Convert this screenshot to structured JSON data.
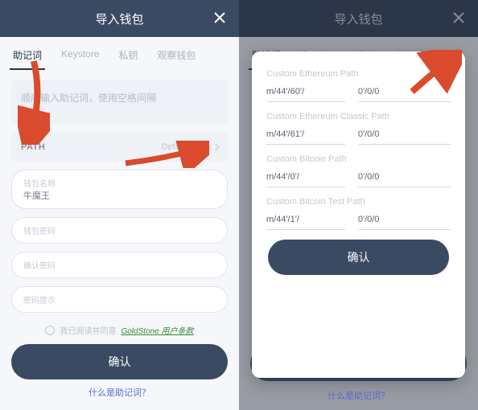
{
  "left": {
    "header": {
      "title": "导入钱包"
    },
    "tabs": [
      "助记词",
      "Keystore",
      "私钥",
      "观察钱包"
    ],
    "activeTabIndex": 0,
    "mnemonicPlaceholder": "顺序输入助记词，使用空格间隔",
    "path": {
      "label": "PATH",
      "value": "Default Path"
    },
    "fields": {
      "name": {
        "label": "钱包名称",
        "value": "牛魔王"
      },
      "password": {
        "label": "钱包密码"
      },
      "confirmPassword": {
        "label": "确认密码"
      },
      "hint": {
        "label": "密码提示"
      }
    },
    "agree": {
      "prefix": "我已阅读并同意",
      "link": "GoldStone 用户条款"
    },
    "confirm": "确认",
    "whatLink": "什么是助记词？"
  },
  "right": {
    "header": {
      "title": "导入钱包"
    },
    "tabs": [
      "助记词",
      "Keystore",
      "私钥",
      "观察钱包"
    ],
    "modal": {
      "groups": [
        {
          "label": "Custom Ethereum Path",
          "prefix": "m/44'/60'/",
          "suffix": "0'/0/0"
        },
        {
          "label": "Custom Ethereum Classic Path",
          "prefix": "m/44'/61'/",
          "suffix": "0'/0/0"
        },
        {
          "label": "Custom Bitcoin Path",
          "prefix": "m/44'/0'/",
          "suffix": "0'/0/0"
        },
        {
          "label": "Custom Bitcoin Test Path",
          "prefix": "m/44'/1'/",
          "suffix": "0'/0/0"
        }
      ],
      "confirm": "确认"
    },
    "confirm": "确认",
    "whatLink": "什么是助记词？"
  }
}
